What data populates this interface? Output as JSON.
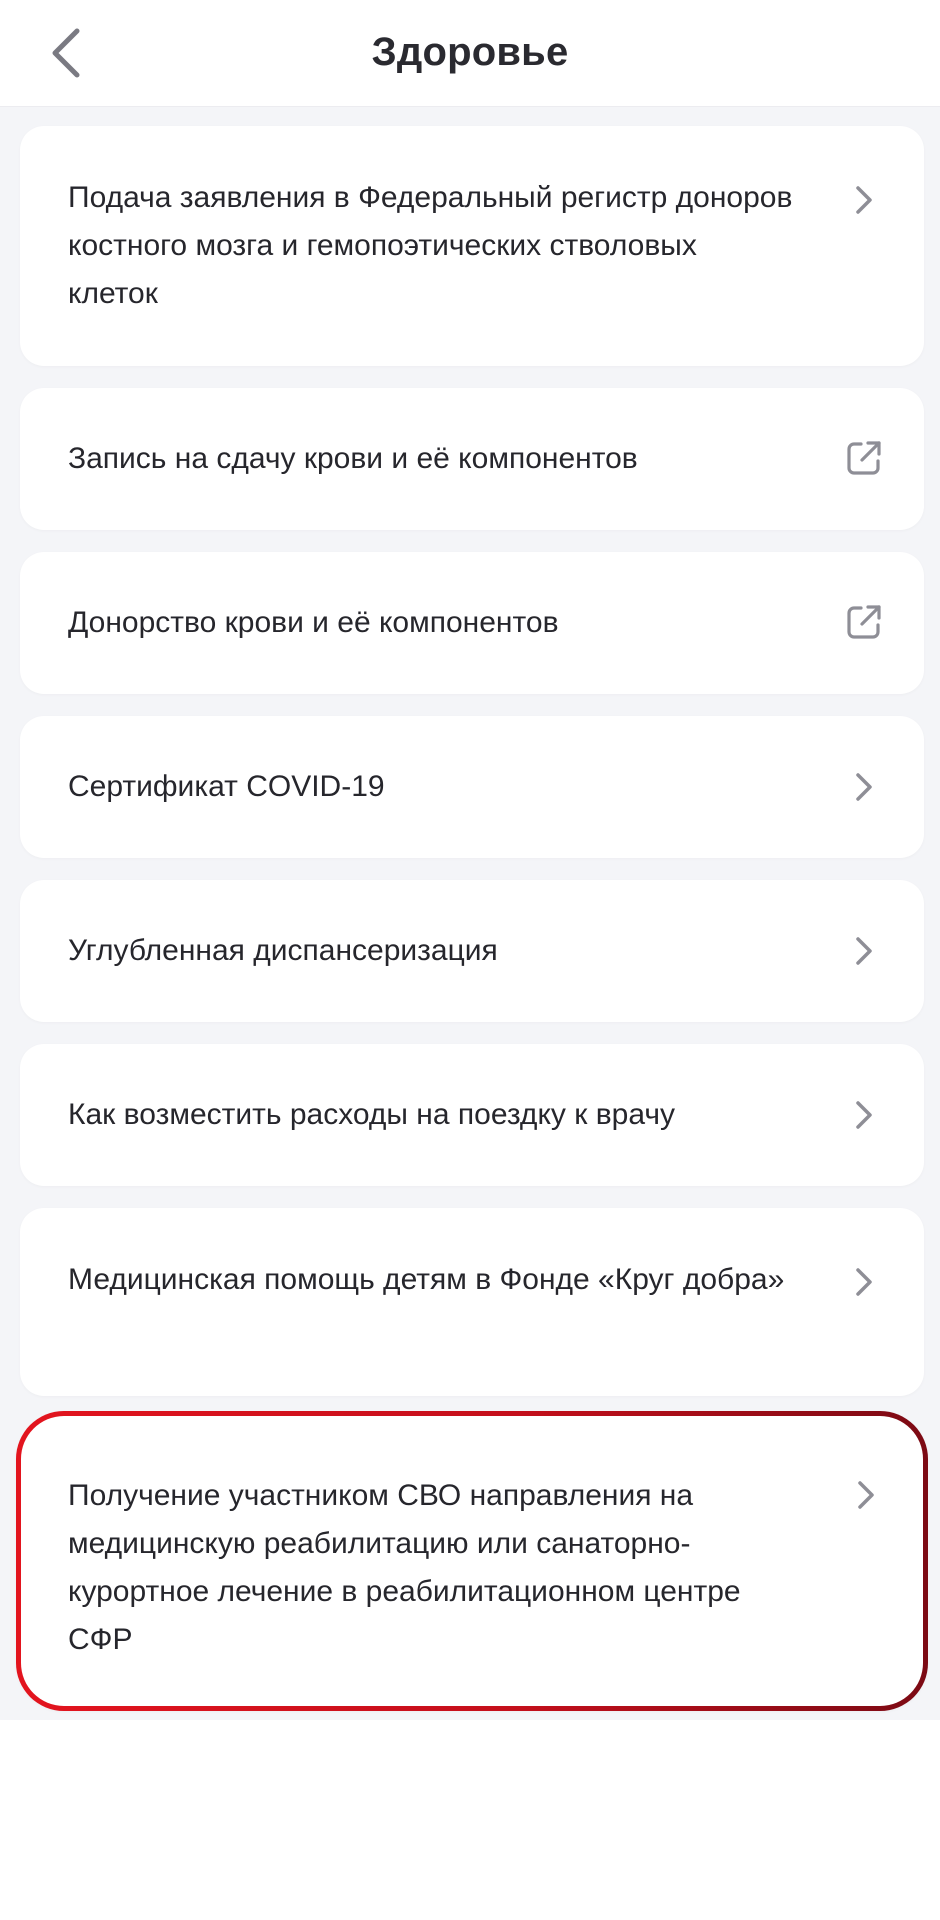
{
  "header": {
    "title": "Здоровье",
    "back_icon": "chevron-left-icon"
  },
  "items": [
    {
      "label": "Подача заявления в Федеральный регистр доноров костного мозга и гемопоэтических стволовых клеток",
      "icon": "chevron-right-icon"
    },
    {
      "label": "Запись на сдачу крови и её компонентов",
      "icon": "external-link-icon"
    },
    {
      "label": "Донорство крови и её компонентов",
      "icon": "external-link-icon"
    },
    {
      "label": "Сертификат COVID-19",
      "icon": "chevron-right-icon"
    },
    {
      "label": "Углубленная диспансеризация",
      "icon": "chevron-right-icon"
    },
    {
      "label": "Как возместить расходы на поездку к врачу",
      "icon": "chevron-right-icon"
    },
    {
      "label": "Медицинская помощь детям в Фонде «Круг добра»",
      "icon": "chevron-right-icon"
    },
    {
      "label": "Получение участником СВО направления на медицинскую реабилитацию или санаторно-курортное лечение в реабилитационном центре СФР",
      "icon": "chevron-right-icon",
      "highlighted": true
    }
  ],
  "colors": {
    "highlight_start": "#e3141e",
    "highlight_end": "#7c0a14",
    "icon": "#8e8e96",
    "background": "#f4f5f8"
  }
}
